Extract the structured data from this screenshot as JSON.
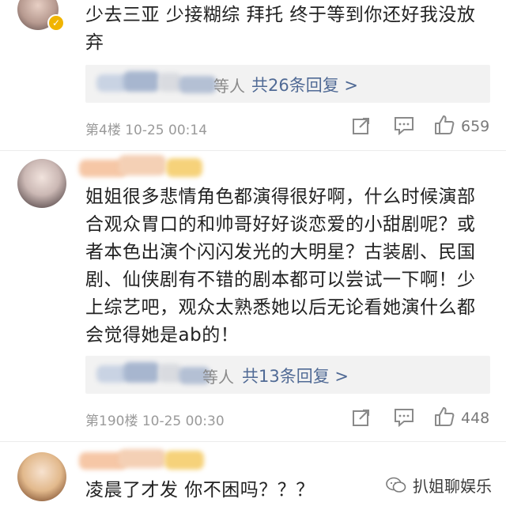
{
  "comments": [
    {
      "text": "少去三亚 少接糊综 拜托 终于等到你还好我没放弃",
      "reply_suffix": "等人",
      "reply_count_label": "共26条回复 >",
      "floor_meta": "第4楼 10-25 00:14",
      "like_count": "659"
    },
    {
      "text": "姐姐很多悲情角色都演得很好啊，什么时候演部合观众胃口的和帅哥好好谈恋爱的小甜剧呢？或者本色出演个闪闪发光的大明星？古装剧、民国剧、仙侠剧有不错的剧本都可以尝试一下啊！少上综艺吧，观众太熟悉她以后无论看她演什么都会觉得她是ab的！",
      "reply_suffix": "等人",
      "reply_count_label": "共13条回复 >",
      "floor_meta": "第190楼 10-25 00:30",
      "like_count": "448"
    },
    {
      "text": "凌晨了才发 你不困吗？？？"
    }
  ],
  "watermark": {
    "label": "扒姐聊娱乐"
  },
  "colors": {
    "link": "#506a95",
    "meta": "#9a9a9a",
    "reply_bg": "#f2f2f2",
    "verified_badge": "#f0b400"
  }
}
